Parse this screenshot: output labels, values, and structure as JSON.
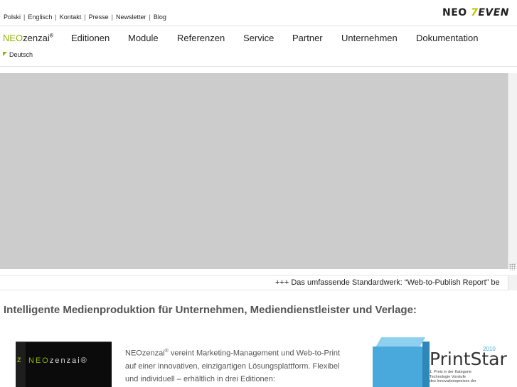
{
  "topbar": {
    "links": [
      "Polski",
      "Englisch",
      "Kontakt",
      "Presse",
      "Newsletter",
      "Blog"
    ],
    "logo_left": "NEO",
    "logo_seven": "7",
    "logo_right": "EVEN"
  },
  "nav": {
    "brand_prefix": "NEO",
    "brand_suffix": "zenzai",
    "brand_reg": "®",
    "items": [
      "Editionen",
      "Module",
      "Referenzen",
      "Service",
      "Partner",
      "Unternehmen",
      "Dokumentation"
    ]
  },
  "language": {
    "current": "Deutsch"
  },
  "ticker": {
    "text": "+++  Das umfassende Standardwerk: “Web-to-Publish Report” be"
  },
  "main": {
    "headline": "Intelligente Medienproduktion für Unternehmen, Mediendienstleister und Verlage:",
    "product_mark": "Z",
    "product_brand_prefix": "NEO",
    "product_brand_suffix": "zenzai®",
    "intro_brand": "NEOzenzai",
    "intro_reg": "®",
    "intro_line1": " vereint Marketing-Management und Web-to-Print",
    "intro_line2": "auf einer innovativen, einzigartigen Lösungsplattform. Flexibel",
    "intro_line3": "und individuell – erhältlich in drei Editionen:"
  },
  "award": {
    "year": "2010",
    "title": "PrintStar",
    "line1": "1. Preis in der Kategorie",
    "line2": "Technologie Vorstufe",
    "line3": "des Innovationspreises der"
  },
  "colors": {
    "accent_green": "#8db600",
    "hero_gray": "#cccccc",
    "award_blue": "#4aa9dc"
  }
}
